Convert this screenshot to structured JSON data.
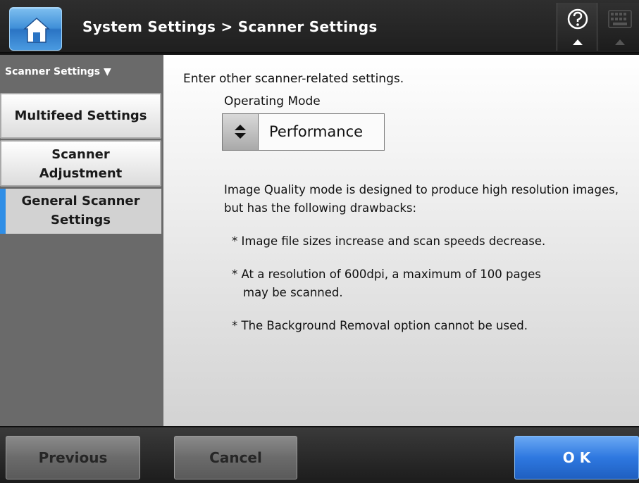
{
  "header": {
    "title": "System Settings > Scanner Settings",
    "home_icon": "home-icon",
    "help_icon": "help-icon",
    "keyboard_icon": "keyboard-icon"
  },
  "sidebar": {
    "header": "Scanner Settings ▼",
    "items": [
      {
        "label_line1": "Multifeed Settings",
        "label_line2": "",
        "state": "inactive"
      },
      {
        "label_line1": "Scanner",
        "label_line2": "Adjustment",
        "state": "inactive"
      },
      {
        "label_line1": "General Scanner",
        "label_line2": "Settings",
        "state": "active"
      }
    ]
  },
  "main": {
    "intro": "Enter other scanner-related settings.",
    "operating_mode_label": "Operating Mode",
    "operating_mode_value": "Performance",
    "note_line1": "Image Quality mode is designed to produce high resolution images,",
    "note_line2": "but has the following drawbacks:",
    "drawback1": "* Image file sizes increase and scan speeds decrease.",
    "drawback2_line1": "* At a resolution of 600dpi, a maximum of 100 pages",
    "drawback2_line2": "may be scanned.",
    "drawback3": "* The Background Removal option cannot be used."
  },
  "footer": {
    "previous": "Previous",
    "cancel": "Cancel",
    "ok": "O K"
  },
  "colors": {
    "accent": "#2f8ee6",
    "ok_button": "#2e78e0",
    "sidebar_bg": "#6a6a6a"
  }
}
